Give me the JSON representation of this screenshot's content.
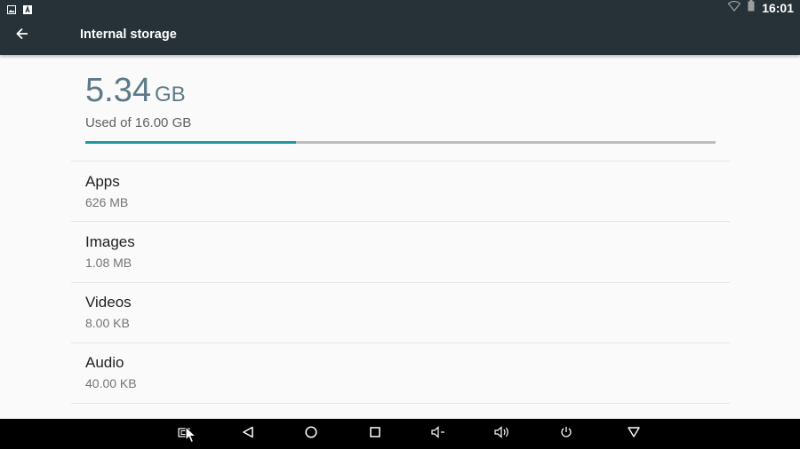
{
  "status_bar": {
    "time": "16:01",
    "left_icons": [
      "gallery-icon",
      "keyboard-a-icon"
    ],
    "right_icons": [
      "wifi-icon",
      "battery-icon"
    ]
  },
  "toolbar": {
    "title": "Internal storage",
    "back_icon": "arrow-back-icon"
  },
  "summary": {
    "used_value": "5.34",
    "used_unit": "GB",
    "used_of_text": "Used of 16.00 GB",
    "progress_fraction": 0.334
  },
  "categories": [
    {
      "title": "Apps",
      "size": "626 MB"
    },
    {
      "title": "Images",
      "size": "1.08 MB"
    },
    {
      "title": "Videos",
      "size": "8.00 KB"
    },
    {
      "title": "Audio",
      "size": "40.00 KB"
    }
  ],
  "nav_bar": {
    "buttons": [
      "screenshot-icon",
      "back-icon",
      "home-icon",
      "recents-icon",
      "volume-down-icon",
      "volume-up-icon",
      "power-icon",
      "hide-bar-icon"
    ]
  },
  "colors": {
    "bar_background": "#263238",
    "accent": "#1c9aa0",
    "used_text": "#5d7a87"
  }
}
